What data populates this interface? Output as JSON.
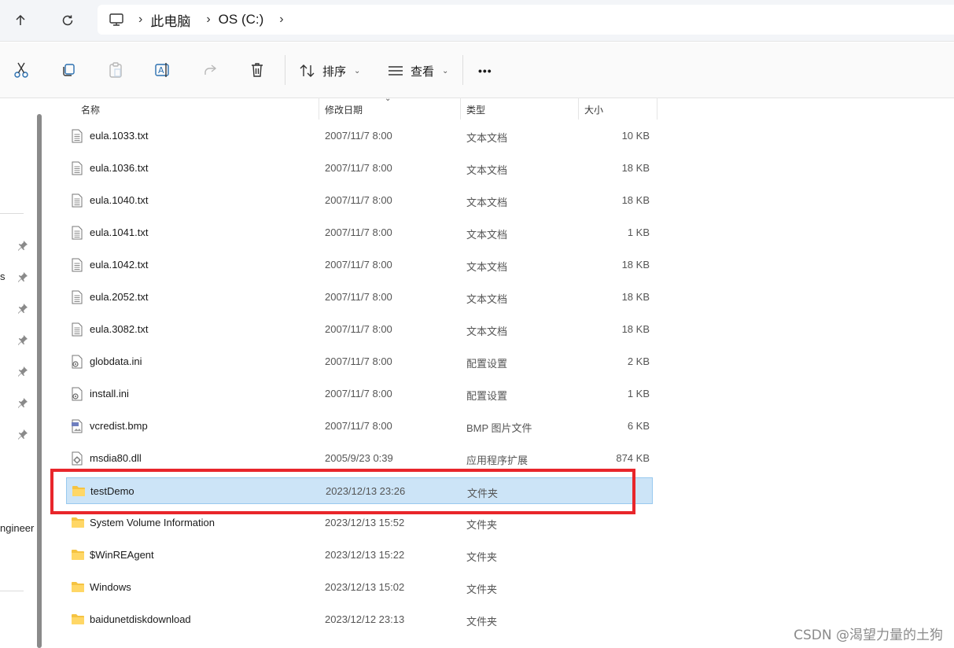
{
  "address": {
    "crumbs": [
      "此电脑",
      "OS (C:)"
    ]
  },
  "toolbar": {
    "sort_label": "排序",
    "view_label": "查看",
    "more_label": "•••"
  },
  "sidebar": {
    "fragment_s": "s",
    "fragment_engineer": "ngineer"
  },
  "columns": {
    "name": "名称",
    "date": "修改日期",
    "type": "类型",
    "size": "大小"
  },
  "files": [
    {
      "name": "eula.1033.txt",
      "date": "2007/11/7 8:00",
      "type": "文本文档",
      "size": "10 KB",
      "icon": "text-file-icon"
    },
    {
      "name": "eula.1036.txt",
      "date": "2007/11/7 8:00",
      "type": "文本文档",
      "size": "18 KB",
      "icon": "text-file-icon"
    },
    {
      "name": "eula.1040.txt",
      "date": "2007/11/7 8:00",
      "type": "文本文档",
      "size": "18 KB",
      "icon": "text-file-icon"
    },
    {
      "name": "eula.1041.txt",
      "date": "2007/11/7 8:00",
      "type": "文本文档",
      "size": "1 KB",
      "icon": "text-file-icon"
    },
    {
      "name": "eula.1042.txt",
      "date": "2007/11/7 8:00",
      "type": "文本文档",
      "size": "18 KB",
      "icon": "text-file-icon"
    },
    {
      "name": "eula.2052.txt",
      "date": "2007/11/7 8:00",
      "type": "文本文档",
      "size": "18 KB",
      "icon": "text-file-icon"
    },
    {
      "name": "eula.3082.txt",
      "date": "2007/11/7 8:00",
      "type": "文本文档",
      "size": "18 KB",
      "icon": "text-file-icon"
    },
    {
      "name": "globdata.ini",
      "date": "2007/11/7 8:00",
      "type": "配置设置",
      "size": "2 KB",
      "icon": "settings-file-icon"
    },
    {
      "name": "install.ini",
      "date": "2007/11/7 8:00",
      "type": "配置设置",
      "size": "1 KB",
      "icon": "settings-file-icon"
    },
    {
      "name": "vcredist.bmp",
      "date": "2007/11/7 8:00",
      "type": "BMP 图片文件",
      "size": "6 KB",
      "icon": "image-file-icon"
    },
    {
      "name": "msdia80.dll",
      "date": "2005/9/23 0:39",
      "type": "应用程序扩展",
      "size": "874 KB",
      "icon": "dll-file-icon"
    },
    {
      "name": "testDemo",
      "date": "2023/12/13 23:26",
      "type": "文件夹",
      "size": "",
      "icon": "folder-icon",
      "selected": true
    },
    {
      "name": "System Volume Information",
      "date": "2023/12/13 15:52",
      "type": "文件夹",
      "size": "",
      "icon": "folder-icon"
    },
    {
      "name": "$WinREAgent",
      "date": "2023/12/13 15:22",
      "type": "文件夹",
      "size": "",
      "icon": "folder-icon"
    },
    {
      "name": "Windows",
      "date": "2023/12/13 15:02",
      "type": "文件夹",
      "size": "",
      "icon": "folder-icon"
    },
    {
      "name": "baidunetdiskdownload",
      "date": "2023/12/12 23:13",
      "type": "文件夹",
      "size": "",
      "icon": "folder-icon"
    }
  ],
  "colors": {
    "selection_bg": "#cce4f7",
    "highlight_border": "#e8262b",
    "folder": "#f5c342"
  },
  "watermark": "CSDN @渴望力量的土狗"
}
